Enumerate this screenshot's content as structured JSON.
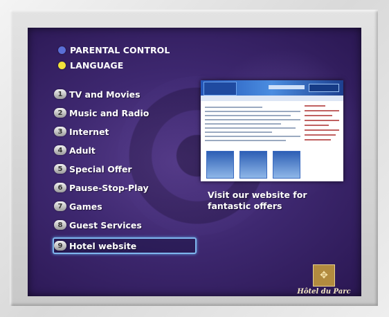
{
  "options": [
    {
      "label": "PARENTAL CONTROL",
      "color": "#5a6fd6"
    },
    {
      "label": "LANGUAGE",
      "color": "#f2e23a"
    }
  ],
  "menu": [
    {
      "number": "1",
      "label": "TV and Movies"
    },
    {
      "number": "2",
      "label": "Music and Radio"
    },
    {
      "number": "3",
      "label": "Internet"
    },
    {
      "number": "4",
      "label": "Adult"
    },
    {
      "number": "5",
      "label": "Special Offer"
    },
    {
      "number": "6",
      "label": "Pause-Stop-Play"
    },
    {
      "number": "7",
      "label": "Games"
    },
    {
      "number": "8",
      "label": "Guest Services"
    },
    {
      "number": "9",
      "label": "Hotel website",
      "selected": true
    }
  ],
  "preview": {
    "caption": "Visit our website for fantastic offers"
  },
  "brand": {
    "name": "Hôtel du Parc",
    "icon": "crest-icon"
  },
  "colors": {
    "screen_bg": "#3e2870",
    "selection_border": "#7fb6ee",
    "text": "#ffffff"
  }
}
